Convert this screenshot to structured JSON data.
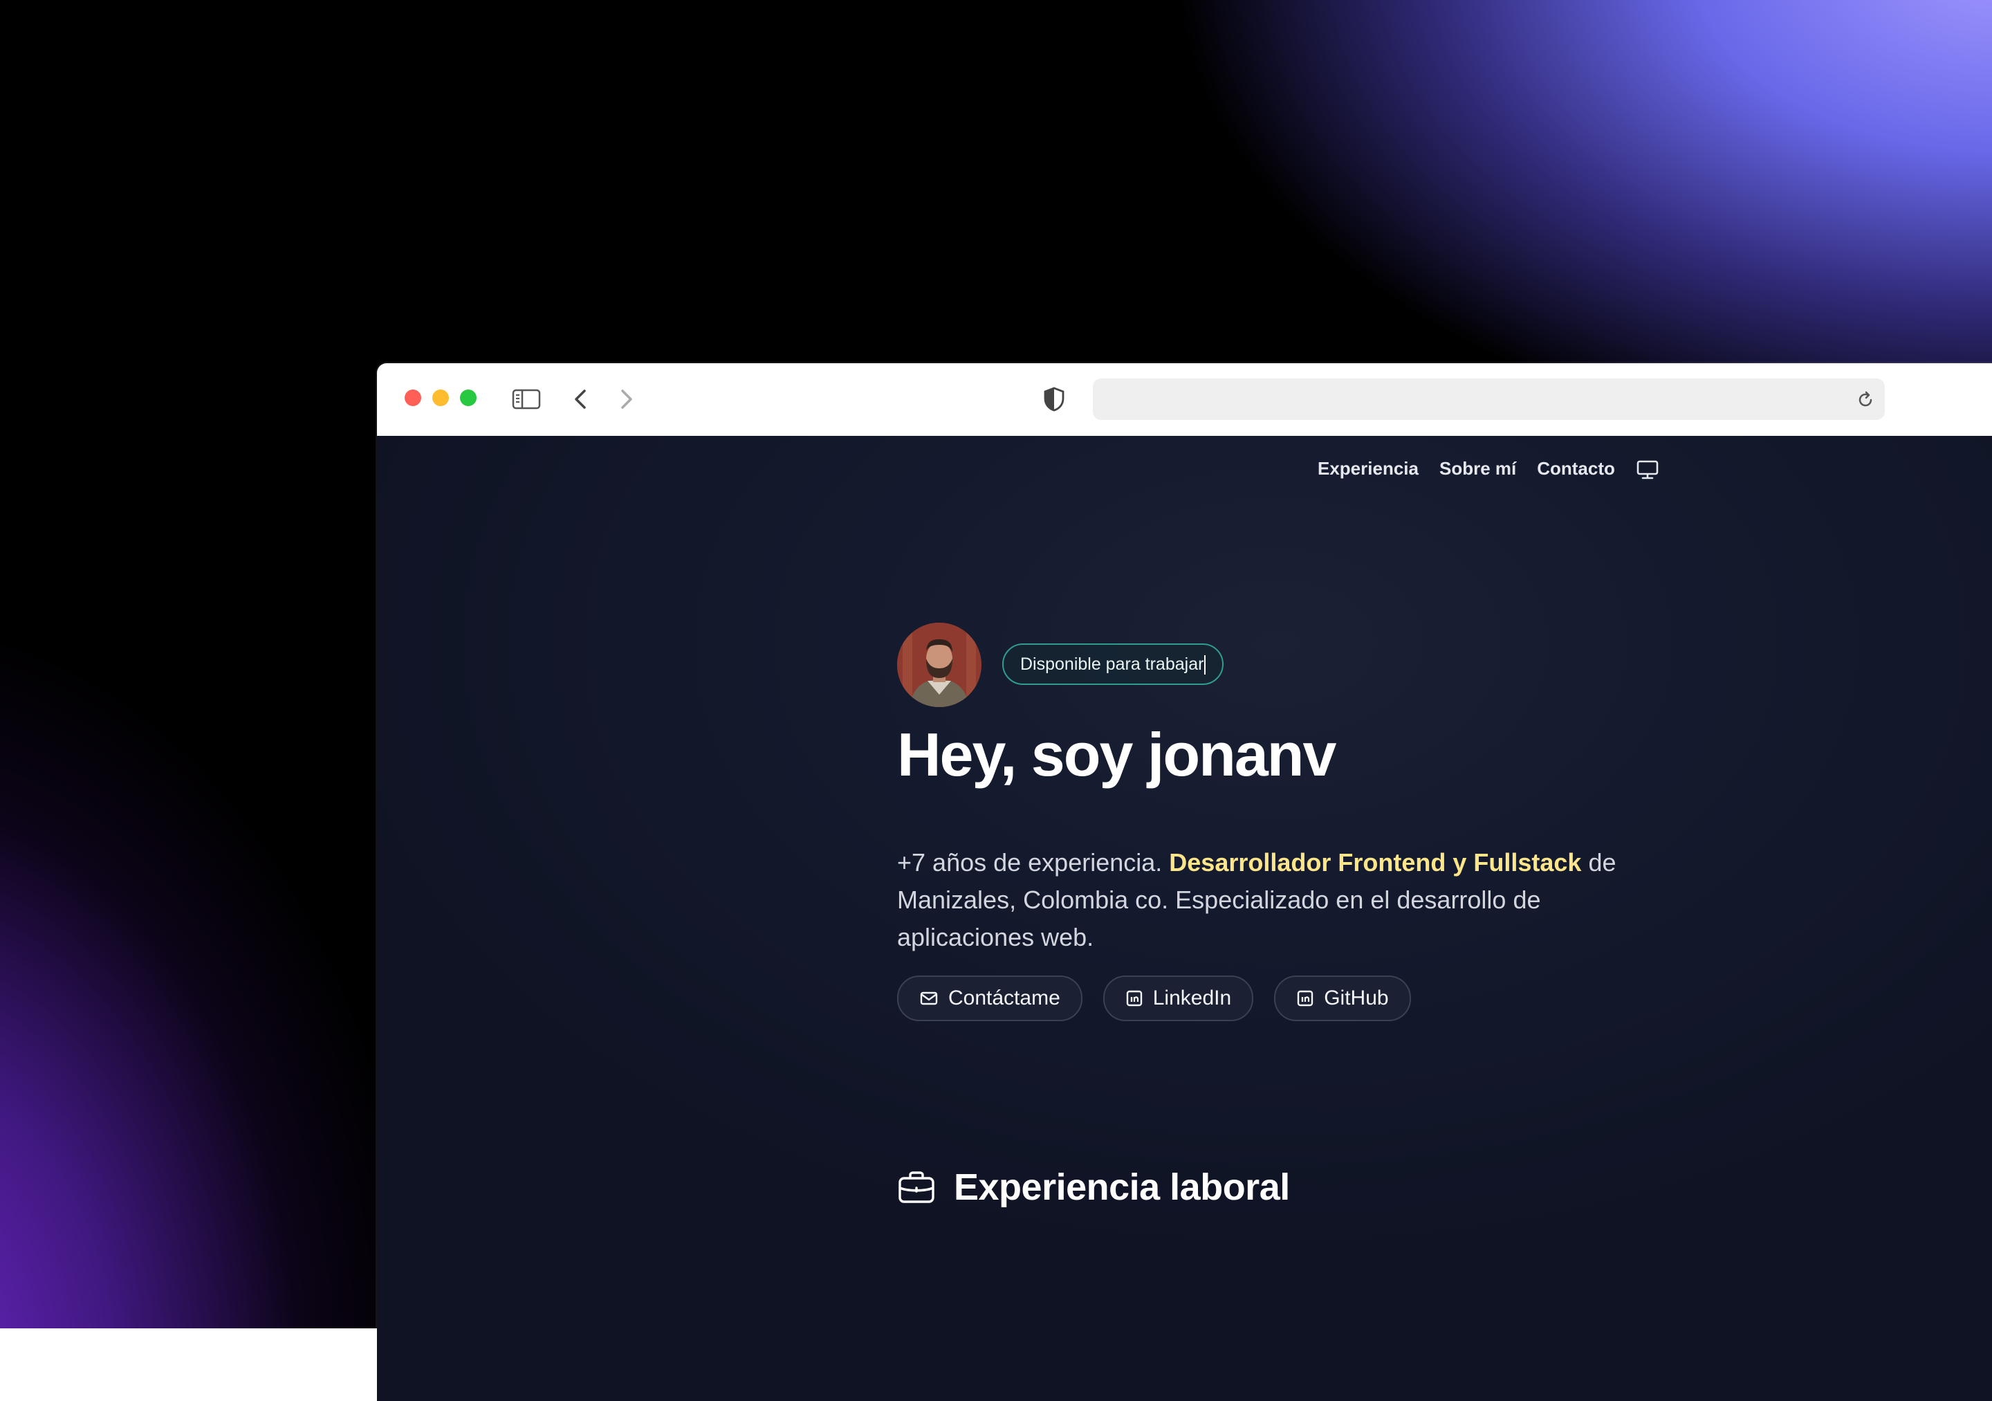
{
  "browser": {
    "url": ""
  },
  "nav": {
    "items": [
      "Experiencia",
      "Sobre mí",
      "Contacto"
    ],
    "theme_icon": "monitor-icon"
  },
  "hero": {
    "badge": "Disponible para trabajar",
    "title": "Hey, soy jonanv",
    "desc_prefix": "+7 años de experiencia. ",
    "desc_highlight": "Desarrollador Frontend y Fullstack",
    "desc_suffix": " de Manizales, Colombia co. Especializado en el desarrollo de aplicaciones web.",
    "buttons": [
      {
        "label": "Contáctame",
        "icon": "mail-icon"
      },
      {
        "label": "LinkedIn",
        "icon": "linkedin-icon"
      },
      {
        "label": "GitHub",
        "icon": "github-icon"
      }
    ]
  },
  "section": {
    "title": "Experiencia laboral",
    "icon": "briefcase-icon"
  },
  "colors": {
    "highlight": "#fde68a",
    "badge_border": "#2f9c8e",
    "page_bg": "#141a2d"
  }
}
